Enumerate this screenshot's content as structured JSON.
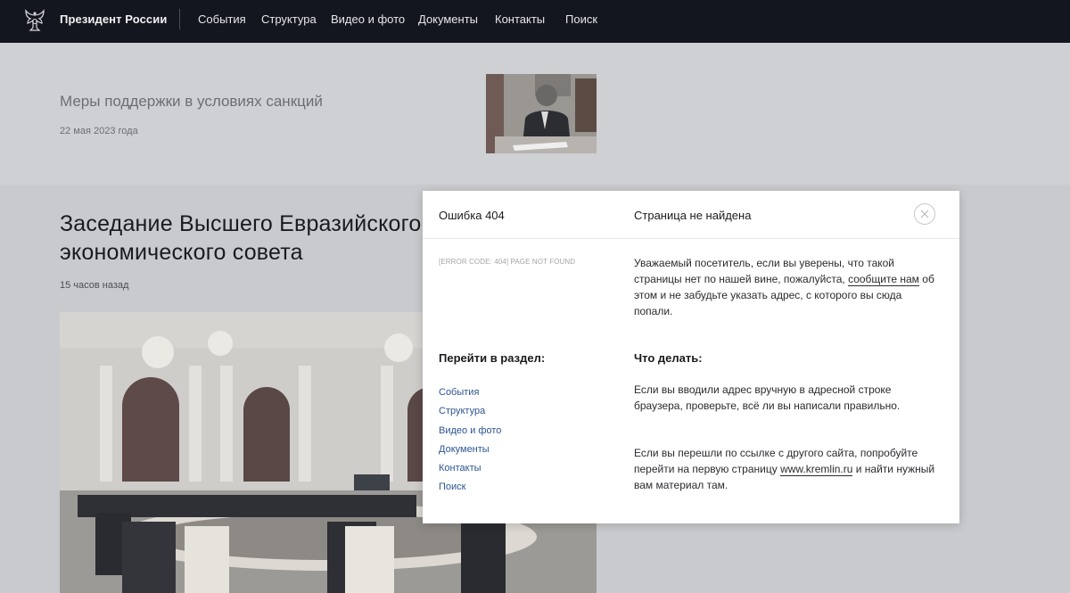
{
  "header": {
    "brand": "Президент России",
    "nav": [
      "События",
      "Структура",
      "Видео и фото",
      "Документы",
      "Контакты",
      "Поиск"
    ]
  },
  "feed": {
    "item1": {
      "title": "Меры поддержки в условиях санкций",
      "date": "22 мая 2023 года"
    },
    "item2": {
      "title": "Заседание Высшего Евразийского экономического совета",
      "date": "15 часов назад"
    }
  },
  "modal": {
    "error_title": "Ошибка 404",
    "not_found": "Страница не найдена",
    "error_code": "[ERROR CODE: 404] PAGE NOT FOUND",
    "message_before": "Уважаемый посетитель, если вы уверены, что такой страницы нет по нашей вине, пожалуйста, ",
    "message_link": "сообщите нам",
    "message_after": " об этом и не забудьте указать адрес, с которого вы сюда попали.",
    "goto_heading": "Перейти в раздел:",
    "sections": [
      "События",
      "Структура",
      "Видео и фото",
      "Документы",
      "Контакты",
      "Поиск"
    ],
    "whatdo_heading": "Что делать:",
    "tip1": "Если вы вводили адрес вручную в адресной строке браузера, проверьте, всё ли вы написали правильно.",
    "tip2_before": "Если вы перешли по ссылке с другого сайта, попробуйте перейти на первую страницу ",
    "tip2_link": "www.kremlin.ru",
    "tip2_after": " и найти нужный вам материал там."
  },
  "colors": {
    "topbar": "#14161f",
    "link": "#2d5592",
    "overlay": "#c9cacd"
  }
}
